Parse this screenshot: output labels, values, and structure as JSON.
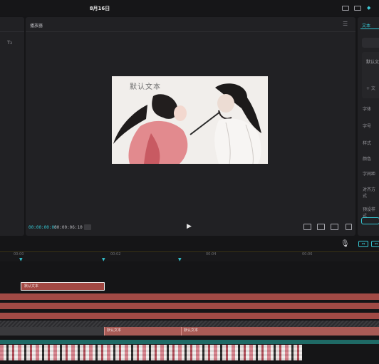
{
  "window": {
    "title": "8月16日"
  },
  "player": {
    "title": "播放器",
    "menu_icon": "menu-icon",
    "preview_text": "默认文本",
    "current_time": "00:00:00:03",
    "total_time": "00:00:06:10",
    "controls": [
      "play-icon",
      "ratio-icon",
      "fullscreen-fit-icon",
      "ratio-label-icon",
      "fullscreen-icon"
    ]
  },
  "left_panel": {
    "tool_label": "T₂"
  },
  "right_panel": {
    "tab": "文本",
    "preset_text": "默认文",
    "preset_icon": "+ 文",
    "props": [
      "字体",
      "字号",
      "样式",
      "颜色",
      "字间距",
      "对齐方式",
      "预设样式"
    ]
  },
  "timeline": {
    "ticks": [
      "00:00",
      "00:02",
      "00:04",
      "00:06"
    ],
    "text_clip": "默认文本",
    "segments": [
      "默认文本",
      "默认文本"
    ],
    "colors": {
      "accent": "#35c4d0",
      "text_clip": "#a24843",
      "track_teal": "#1f6a66"
    }
  }
}
